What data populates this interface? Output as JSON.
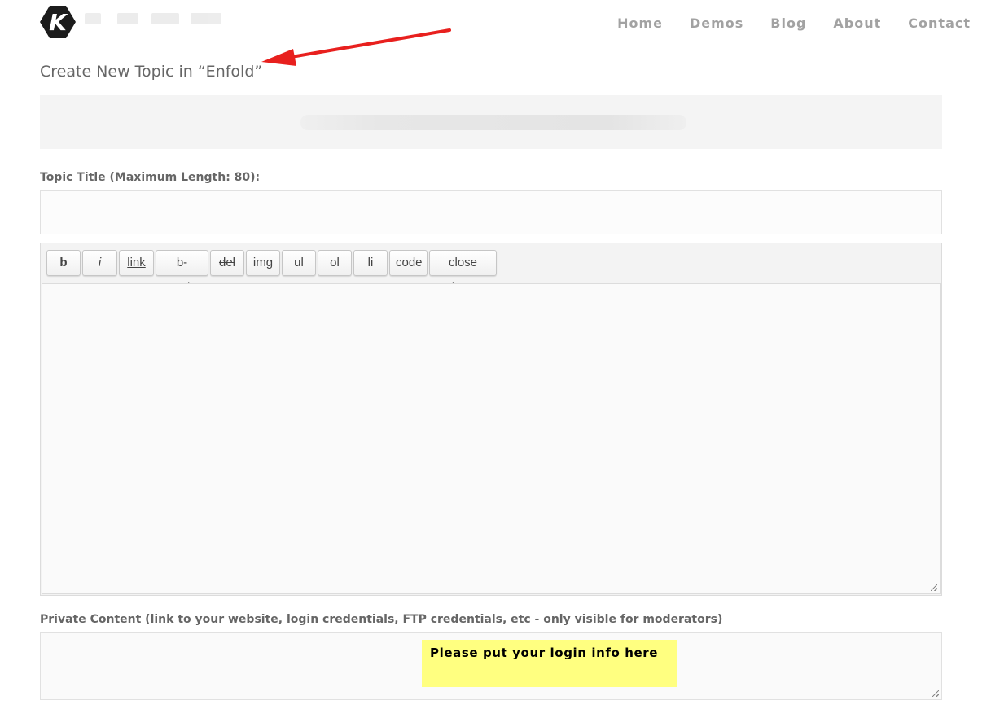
{
  "header": {
    "logo_letter": "K",
    "nav": [
      "Home",
      "Demos",
      "Blog",
      "About",
      "Contact"
    ]
  },
  "page_title": "Create New Topic in “Enfold”",
  "topic_title": {
    "label": "Topic Title (Maximum Length: 80):",
    "value": ""
  },
  "editor": {
    "quicktags": [
      "b",
      "i",
      "link",
      "b-quote",
      "del",
      "img",
      "ul",
      "ol",
      "li",
      "code",
      "close tags"
    ],
    "content": ""
  },
  "private_content": {
    "label": "Private Content (link to your website, login credentials, FTP credentials, etc - only visible for moderators)",
    "value": "",
    "annotation_note": "Please put your login info here"
  },
  "colors": {
    "arrow": "#e8201e",
    "note_background": "#ffff80",
    "nav_text": "#a2a2a2"
  },
  "icons": [
    "logo-icon",
    "resize-grip-icon",
    "annotation-arrow"
  ]
}
